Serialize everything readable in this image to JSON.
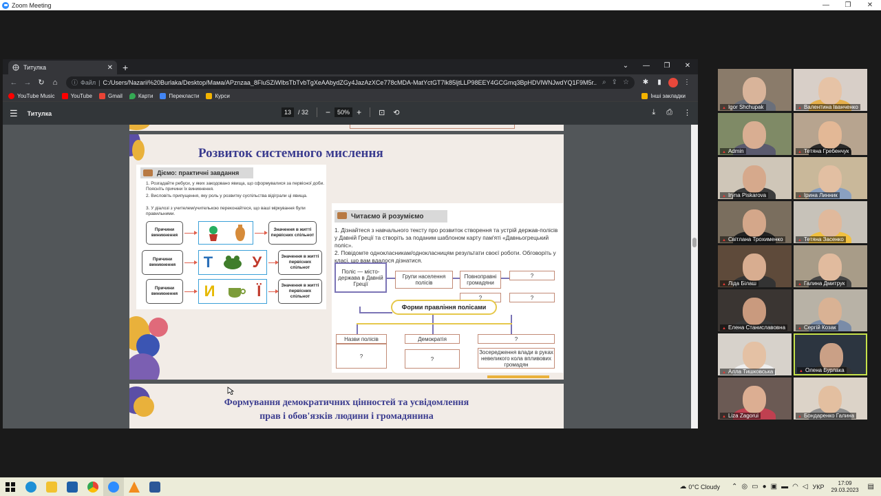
{
  "zoom": {
    "title": "Zoom Meeting"
  },
  "chrome": {
    "tab_title": "Титулка",
    "url_prefix": "Файл",
    "url": "C:/Users/Nazarii%20Burlaka/Desktop/Мама/APznzaa_8FluSZiWlbsTbTvbTgXeAAbydZGy4JazAzXCe778cMDA-MatYctGT7lk85ljtLLP98EEY4GCGmq3BpHDVlWNJwdYQ1F9M5r...",
    "bookmarks": [
      "YouTube Music",
      "YouTube",
      "Gmail",
      "Карти",
      "Перекласти",
      "Курси"
    ],
    "bookmarks_other": "Інші закладки"
  },
  "pdf": {
    "title": "Титулка",
    "page_current": "13",
    "page_total": "/ 32",
    "zoom": "50%"
  },
  "page": {
    "title": "Розвиток системного мислення",
    "left_header": "Діємо: практичні завдання",
    "left_tasks": [
      "1. Розгадайте ребуси, у яких закодовано явища, що сформувалися за первісної доби. Поясніть причини їх виникнення.",
      "2. Висловіть припущення, яку роль у розвитку суспільства відіграли ці явища.",
      "3. У діалозі з учителем/учителькою переконайтеся, що ваші міркування були правильними."
    ],
    "box_cause": "Причини виникнення",
    "box_meaning": "Значення в житті первісних спільнот",
    "rebus2": [
      "Т",
      "У"
    ],
    "rebus3": [
      "И",
      "Ї"
    ],
    "right_header": "Читаємо й розуміємо",
    "right_tasks": [
      "1. Дізнайтеся з навчального тексту про розвиток створення та устрій держав-полісів у Давній Греції та створіть за поданим шаблоном карту пам'яті «Давньогрецький поліс».",
      "2. Повідомте однокласникам/однокласницям результати своєї роботи. Обговоріть у класі, що вам вдалося дізнатися."
    ],
    "map": {
      "center": "Поліс — місто-держава в Давній Греції",
      "groups": "Групи населення полісів",
      "full": "Повноправні громадяни",
      "q": "?",
      "forms": "Форми правління полісами",
      "names": "Назви полісів",
      "democracy": "Демократія",
      "few": "Зосередження влади в руках невеликого кола впливових громадян"
    },
    "next_title_1": "Формування демократичних цінностей та усвідомлення",
    "next_title_2": "прав і обов'язків людини і громадянина"
  },
  "participants": [
    "Igor Shchupak",
    "Валентина Іванченко",
    "Admin",
    "Тетяна Гребенчук",
    "Iryna Piskarova",
    "Ірина Линник",
    "Світлана Трохименко",
    "Тетяна Засенко",
    "Ліда Білаш",
    "Галина Дмитрук",
    "Елена Станиславовна",
    "Сергій Козак",
    "Алла Тишковська",
    "Олена Бурлака",
    "Liza Zagorui",
    "Бондаренко Галина"
  ],
  "taskbar": {
    "weather": "0°C  Cloudy",
    "lang": "УКР",
    "time": "17:09",
    "date": "29.03.2023"
  }
}
